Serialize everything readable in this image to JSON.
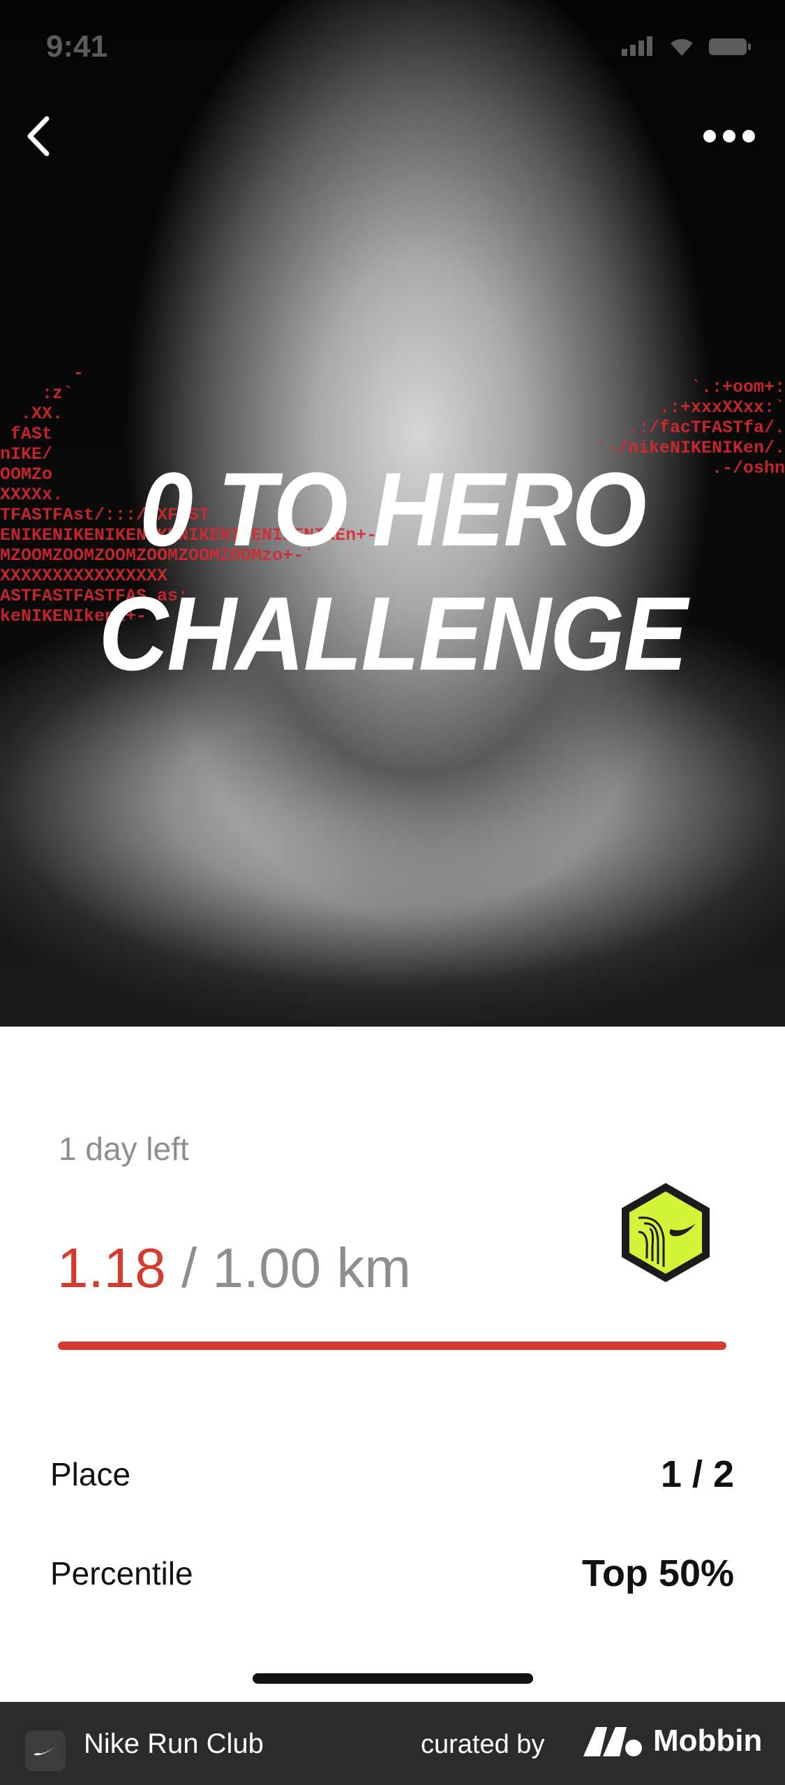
{
  "status_bar": {
    "time": "9:41"
  },
  "hero": {
    "title_line1": "0 TO HERO",
    "title_line2": "CHALLENGE",
    "code_rain_left": "       -\n    :z`\n  .XX.\n fASt\nnIKE/\nOOMZo\nXXXXx.\nTFASTFAst/:::/ XFAST\nENIKENIKENIKENIKENIKENIKENIKENIKEn+-\nMZOOMZOOMZOOMZOOMZOOMZOOMzo+-`\nXXXXXXXXXXXXXXXX\nASTFASTFASTFAS as:\nkeNIKENIkeni+-",
    "code_rain_right": "`.:+oom+:\n.:+xxxXXxx:`\n.:/facTFASTfa/.\n`-/nikeNIKENIKen/.\n.-/oshn"
  },
  "navigation": {
    "back_icon": "chevron-left-icon",
    "more_icon": "ellipsis-icon"
  },
  "challenge": {
    "time_left": "1 day left",
    "current_distance": "1.18",
    "goal_distance": "/ 1.00 km",
    "progress_fraction": 1.0,
    "badge_icon": "nike-hexagon-badge-icon",
    "accent_color": "#d43b2e",
    "badge_color": "#d4f43a"
  },
  "stats": [
    {
      "label": "Place",
      "value": "1 / 2"
    },
    {
      "label": "Percentile",
      "value": "Top 50%"
    }
  ],
  "footer": {
    "app_name": "Nike Run Club",
    "curated_by": "curated by",
    "brand": "Mobbin"
  }
}
